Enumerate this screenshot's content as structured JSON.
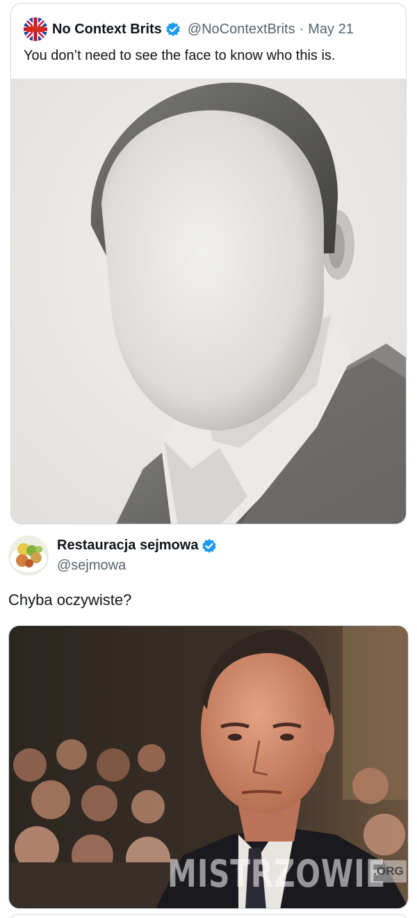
{
  "quoted_tweet": {
    "author_name": "No Context Brits",
    "handle": "@NoContextBrits",
    "separator": "·",
    "date": "May 21",
    "text": "You don’t need to see the face to know who this is.",
    "avatar_icon": "union-jack-flag-icon",
    "verified_icon": "verified-badge-icon",
    "media": "pencil-drawing-faceless-man-in-suit"
  },
  "main_tweet": {
    "author_name": "Restauracja sejmowa",
    "handle": "@sejmowa",
    "text": "Chyba oczywiste?",
    "avatar_icon": "food-plate-avatar",
    "verified_icon": "verified-badge-icon",
    "media": "photo-bald-man-in-suit-in-crowd"
  },
  "watermark": {
    "text": "MISTRZOWIE",
    "suffix": ".ORG"
  },
  "colors": {
    "verified": "#1d9bf0",
    "secondary_text": "#536471",
    "border": "#cfd9de"
  }
}
